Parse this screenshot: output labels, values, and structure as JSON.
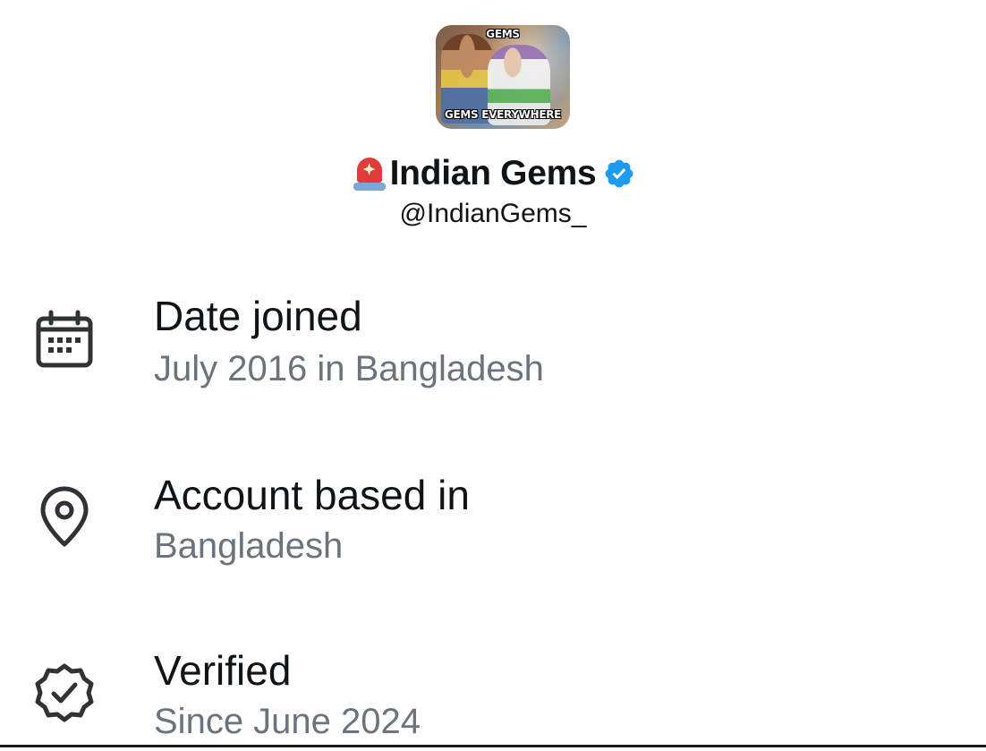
{
  "profile": {
    "avatar_text_top": "GEMS",
    "avatar_text_bottom": "GEMS EVERYWHERE",
    "name_emoji_icon": "police-car-light-icon",
    "display_name": "Indian Gems",
    "verified_icon": "verified-badge-icon",
    "handle": "@IndianGems_"
  },
  "info": {
    "date_joined": {
      "icon": "calendar-icon",
      "title": "Date joined",
      "value": "July 2016 in Bangladesh"
    },
    "account_based": {
      "icon": "location-pin-icon",
      "title": "Account based in",
      "value": "Bangladesh"
    },
    "verified": {
      "icon": "verified-seal-icon",
      "title": "Verified",
      "value": "Since June 2024"
    }
  },
  "colors": {
    "primary_text": "#0f1419",
    "secondary_text": "#6b747c",
    "verified_blue": "#1d9bf0",
    "background": "#ffffff"
  }
}
